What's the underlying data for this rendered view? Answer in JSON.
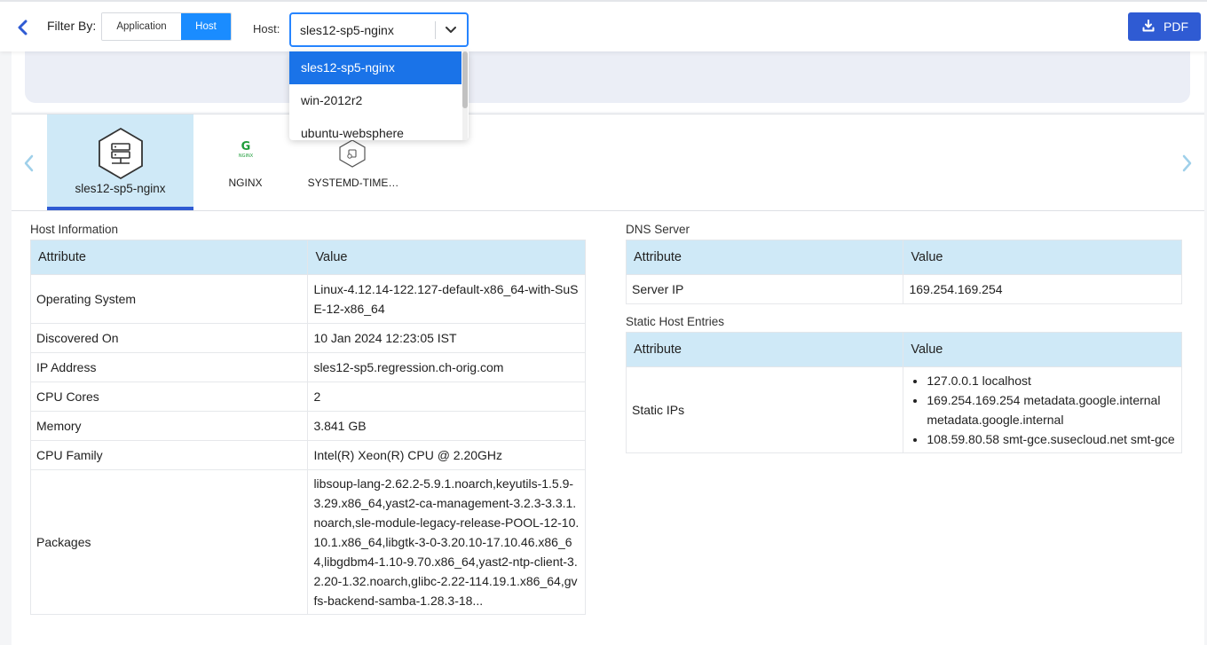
{
  "topbar": {
    "filter_label": "Filter By:",
    "filter_options": [
      "Application",
      "Host"
    ],
    "selected_filter": "Host",
    "host_label": "Host:",
    "host_value": "sles12-sp5-nginx",
    "pdf_label": "PDF"
  },
  "dropdown": {
    "options": [
      "sles12-sp5-nginx",
      "win-2012r2",
      "ubuntu-websphere"
    ],
    "selected": "sles12-sp5-nginx"
  },
  "carousel": {
    "items": [
      {
        "label": "sles12-sp5-nginx",
        "icon": "server-hex-icon"
      },
      {
        "label": "NGINX",
        "icon": "nginx-logo-icon"
      },
      {
        "label": "SYSTEMD-TIME…",
        "icon": "service-hex-icon"
      }
    ],
    "nginx_logo_letter": "G",
    "nginx_logo_text": "NGINX"
  },
  "host_info": {
    "title": "Host Information",
    "headers": [
      "Attribute",
      "Value"
    ],
    "rows": [
      {
        "attribute": "Operating System",
        "value": "Linux-4.12.14-122.127-default-x86_64-with-SuSE-12-x86_64"
      },
      {
        "attribute": "Discovered On",
        "value": "10 Jan 2024 12:23:05 IST"
      },
      {
        "attribute": "IP Address",
        "value": "sles12-sp5.regression.ch-orig.com"
      },
      {
        "attribute": "CPU Cores",
        "value": "2"
      },
      {
        "attribute": "Memory",
        "value": "3.841 GB"
      },
      {
        "attribute": "CPU Family",
        "value": "Intel(R) Xeon(R) CPU @ 2.20GHz"
      },
      {
        "attribute": "Packages",
        "value": "libsoup-lang-2.62.2-5.9.1.noarch,keyutils-1.5.9-3.29.x86_64,yast2-ca-management-3.2.3-3.3.1.noarch,sle-module-legacy-release-POOL-12-10.10.1.x86_64,libgtk-3-0-3.20.10-17.10.46.x86_64,libgdbm4-1.10-9.70.x86_64,yast2-ntp-client-3.2.20-1.32.noarch,glibc-2.22-114.19.1.x86_64,gvfs-backend-samba-1.28.3-18..."
      }
    ]
  },
  "dns": {
    "title": "DNS Server",
    "headers": [
      "Attribute",
      "Value"
    ],
    "rows": [
      {
        "attribute": "Server IP",
        "value": "169.254.169.254"
      }
    ]
  },
  "static_hosts": {
    "title": "Static Host Entries",
    "headers": [
      "Attribute",
      "Value"
    ],
    "attribute": "Static IPs",
    "entries": [
      "127.0.0.1 localhost",
      "169.254.169.254 metadata.google.internal metadata.google.internal",
      "108.59.80.58 smt-gce.susecloud.net smt-gce"
    ]
  },
  "colors": {
    "accent": "#1a8cff",
    "pdf_button": "#2f5bd3",
    "table_header": "#cfe9f7",
    "active_tab_bg": "#cfe9f7",
    "active_tab_border": "#2f5bd3",
    "nginx_green": "#1f9d3a"
  }
}
